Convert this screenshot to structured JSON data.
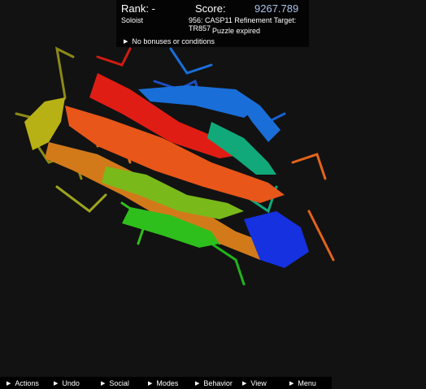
{
  "hud": {
    "rank_label": "Rank: -",
    "score_label": "Score:",
    "score_value": "9267.789",
    "mode": "Soloist",
    "puzzle_target": "956: CASP11 Refinement Target: TR857",
    "status": "Puzzle expired",
    "bonus_text": "No bonuses or conditions"
  },
  "menu": [
    "Actions",
    "Undo",
    "Social",
    "Modes",
    "Behavior",
    "View",
    "Menu"
  ],
  "colors": {
    "background": "#121212",
    "score": "#a9c3ea",
    "rainbow": [
      "#e01d14",
      "#e8561a",
      "#d27a1a",
      "#b8b116",
      "#7ab91a",
      "#2fbf1c",
      "#11a97a",
      "#1a6ed8",
      "#1631e0"
    ]
  }
}
